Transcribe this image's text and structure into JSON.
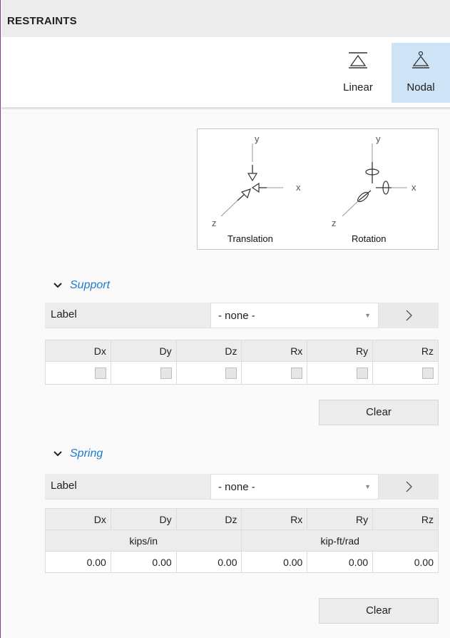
{
  "header": {
    "title": "RESTRAINTS"
  },
  "toolbar": {
    "linear_label": "Linear",
    "nodal_label": "Nodal",
    "selected": "Nodal",
    "selected_color": "#cfe3f7"
  },
  "legend": {
    "translation": {
      "caption": "Translation",
      "y": "y",
      "x": "x",
      "z": "z"
    },
    "rotation": {
      "caption": "Rotation",
      "y": "y",
      "x": "x",
      "z": "z"
    }
  },
  "support": {
    "title": "Support",
    "label_text": "Label",
    "label_value": "- none -",
    "columns": [
      "Dx",
      "Dy",
      "Dz",
      "Rx",
      "Ry",
      "Rz"
    ],
    "checked": [
      false,
      false,
      false,
      false,
      false,
      false
    ],
    "clear_label": "Clear"
  },
  "spring": {
    "title": "Spring",
    "label_text": "Label",
    "label_value": "- none -",
    "columns": [
      "Dx",
      "Dy",
      "Dz",
      "Rx",
      "Ry",
      "Rz"
    ],
    "units": [
      "kips/in",
      "kip-ft/rad"
    ],
    "values": [
      "0.00",
      "0.00",
      "0.00",
      "0.00",
      "0.00",
      "0.00"
    ],
    "clear_label": "Clear"
  },
  "colors": {
    "accent": "#1f7acc",
    "border_purple": "#8a3c8a"
  }
}
